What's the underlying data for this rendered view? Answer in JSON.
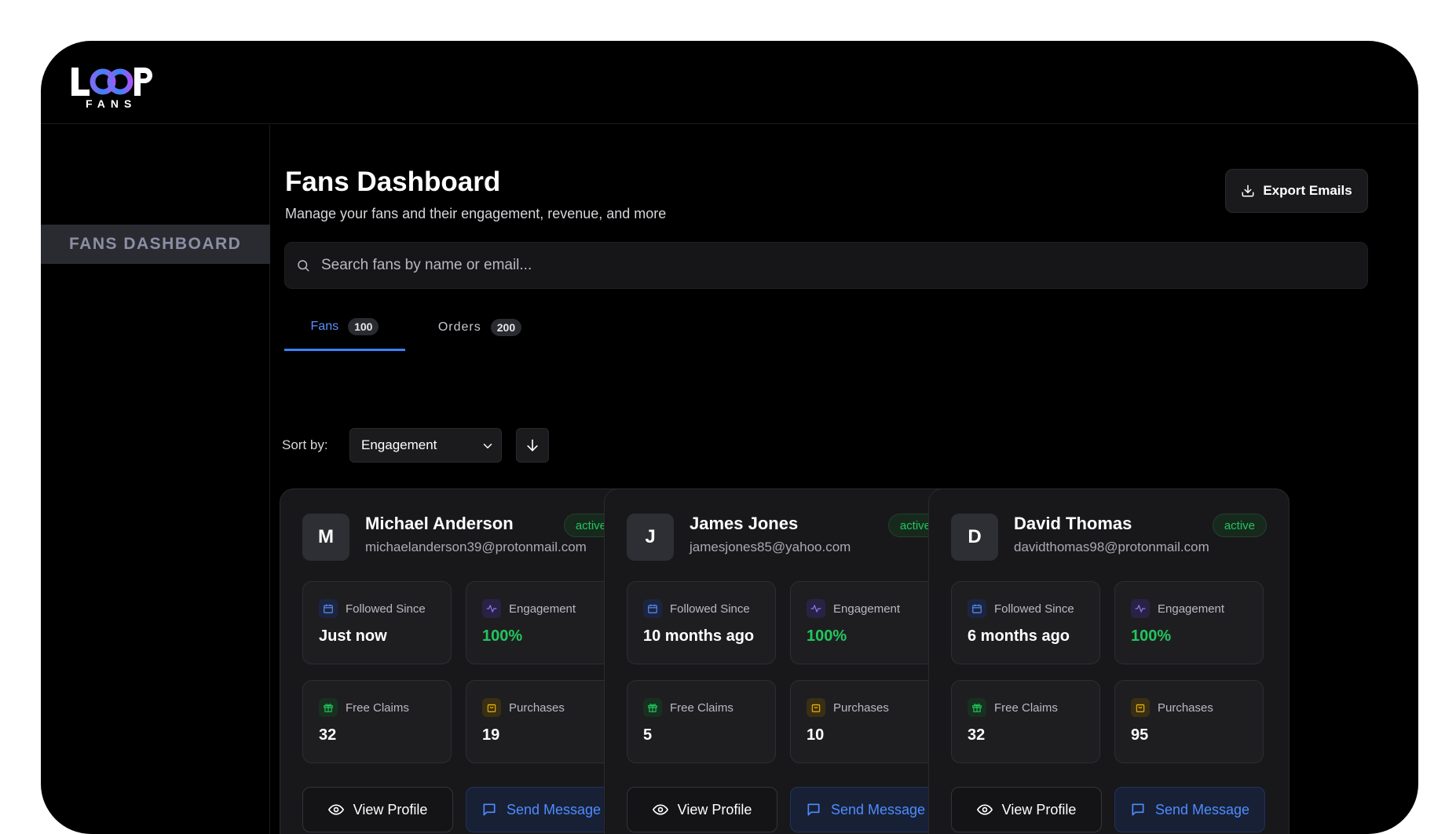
{
  "app": {
    "logo_word": "LOOP",
    "logo_sub": "FANS"
  },
  "sidebar": {
    "items": [
      {
        "label": "FANS DASHBOARD"
      }
    ]
  },
  "header": {
    "title": "Fans Dashboard",
    "subtitle": "Manage your fans and their engagement, revenue, and more",
    "export_label": "Export Emails"
  },
  "search": {
    "placeholder": "Search fans by name or email..."
  },
  "tabs": [
    {
      "label": "Fans",
      "count": "100"
    },
    {
      "label": "Orders",
      "count": "200"
    }
  ],
  "sort": {
    "label": "Sort by:",
    "selected": "Engagement"
  },
  "stat_labels": {
    "followed": "Followed Since",
    "engagement": "Engagement",
    "claims": "Free Claims",
    "purchases": "Purchases"
  },
  "actions": {
    "view": "View Profile",
    "send": "Send Message"
  },
  "fans": [
    {
      "initial": "M",
      "name": "Michael Anderson",
      "email": "michaelanderson39@protonmail.com",
      "status": "active",
      "followed": "Just now",
      "engagement": "100%",
      "claims": "32",
      "purchases": "19"
    },
    {
      "initial": "J",
      "name": "James Jones",
      "email": "jamesjones85@yahoo.com",
      "status": "active",
      "followed": "10 months ago",
      "engagement": "100%",
      "claims": "5",
      "purchases": "10"
    },
    {
      "initial": "D",
      "name": "David Thomas",
      "email": "davidthomas98@protonmail.com",
      "status": "active",
      "followed": "6 months ago",
      "engagement": "100%",
      "claims": "32",
      "purchases": "95"
    }
  ],
  "colors": {
    "accent": "#3b82f6",
    "active": "#22c55e",
    "background": "#000000"
  }
}
